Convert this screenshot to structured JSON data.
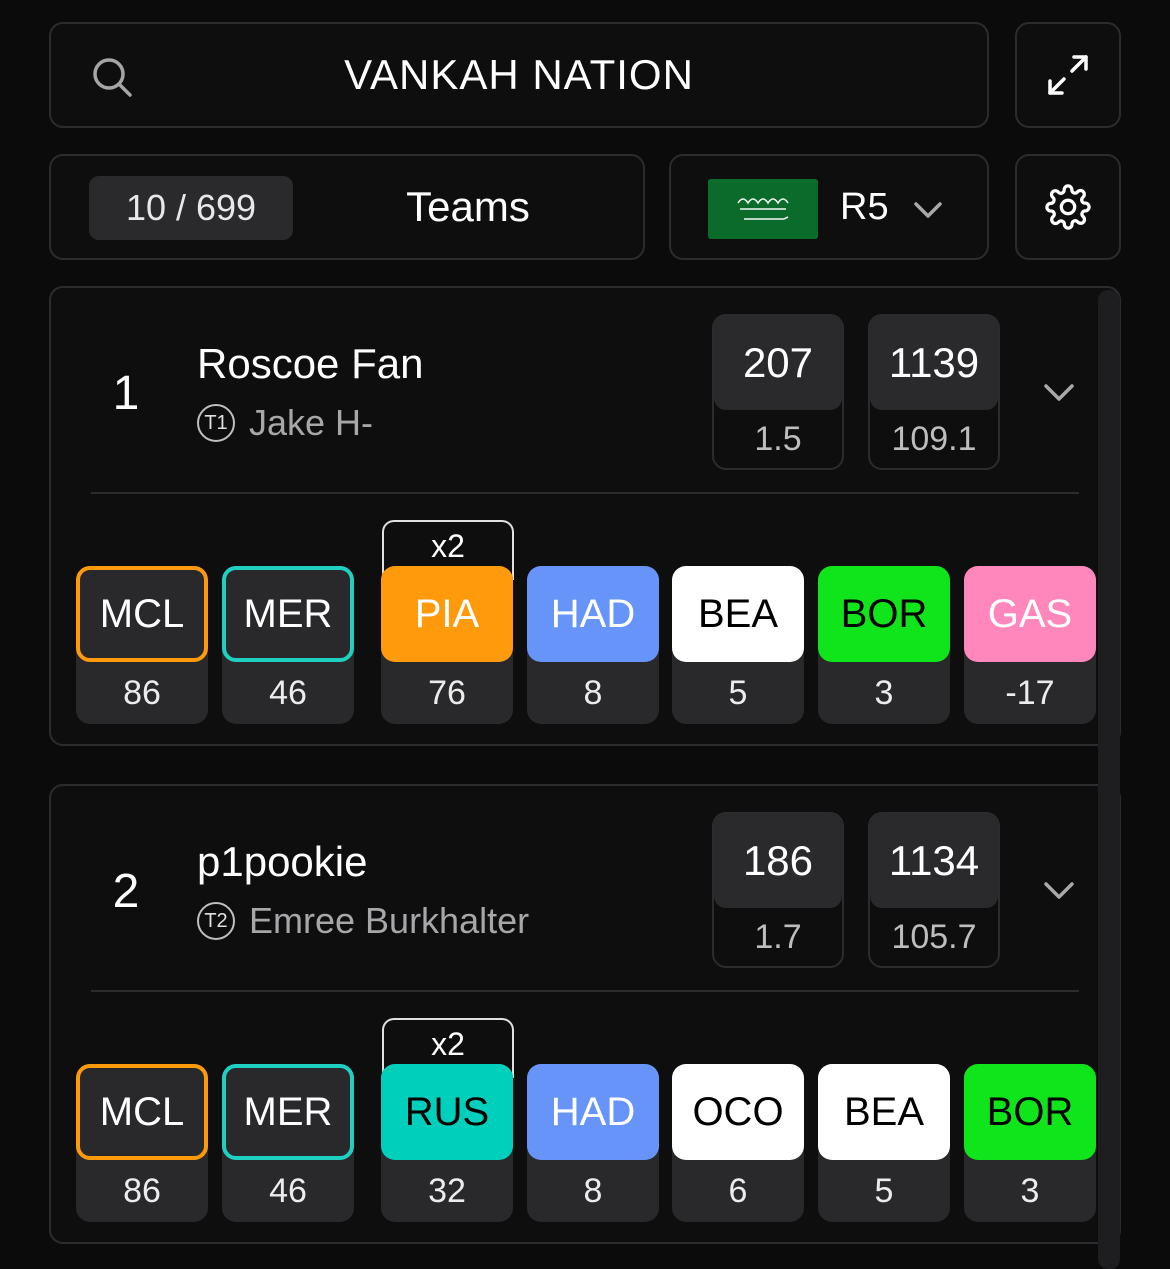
{
  "header": {
    "title": "VANKAH NATION"
  },
  "toolbar": {
    "counter": "10 / 699",
    "view_label": "Teams",
    "round": "R5",
    "flag_icon": "saudi-arabia-flag-icon"
  },
  "teams": [
    {
      "rank": "1",
      "name": "Roscoe Fan",
      "badge": "T1",
      "owner": "Jake H-",
      "stat1_top": "207",
      "stat1_bottom": "1.5",
      "stat2_top": "1139",
      "stat2_bottom": "109.1",
      "multiplier": "x2",
      "picks": [
        {
          "code": "MCL",
          "points": "86",
          "style": "outline",
          "color": "#ff9a0c"
        },
        {
          "code": "MER",
          "points": "46",
          "style": "outline",
          "color": "#1fd0c1"
        },
        {
          "code": "PIA",
          "points": "76",
          "style": "fill",
          "color": "#ff9a0c",
          "text_color": "#ffffff"
        },
        {
          "code": "HAD",
          "points": "8",
          "style": "fill",
          "color": "#6694f9",
          "text_color": "#ffffff"
        },
        {
          "code": "BEA",
          "points": "5",
          "style": "fill",
          "color": "#ffffff",
          "text_color": "#000000"
        },
        {
          "code": "BOR",
          "points": "3",
          "style": "fill",
          "color": "#10e41a",
          "text_color": "#000000"
        },
        {
          "code": "GAS",
          "points": "-17",
          "style": "fill",
          "color": "#ff87bb",
          "text_color": "#ffffff"
        }
      ]
    },
    {
      "rank": "2",
      "name": "p1pookie",
      "badge": "T2",
      "owner": "Emree Burkhalter",
      "stat1_top": "186",
      "stat1_bottom": "1.7",
      "stat2_top": "1134",
      "stat2_bottom": "105.7",
      "multiplier": "x2",
      "picks": [
        {
          "code": "MCL",
          "points": "86",
          "style": "outline",
          "color": "#ff9a0c"
        },
        {
          "code": "MER",
          "points": "46",
          "style": "outline",
          "color": "#1fd0c1"
        },
        {
          "code": "RUS",
          "points": "32",
          "style": "fill",
          "color": "#00d0bb",
          "text_color": "#000000"
        },
        {
          "code": "HAD",
          "points": "8",
          "style": "fill",
          "color": "#6694f9",
          "text_color": "#ffffff"
        },
        {
          "code": "OCO",
          "points": "6",
          "style": "fill",
          "color": "#ffffff",
          "text_color": "#000000"
        },
        {
          "code": "BEA",
          "points": "5",
          "style": "fill",
          "color": "#ffffff",
          "text_color": "#000000"
        },
        {
          "code": "BOR",
          "points": "3",
          "style": "fill",
          "color": "#10e41a",
          "text_color": "#000000"
        }
      ]
    }
  ]
}
